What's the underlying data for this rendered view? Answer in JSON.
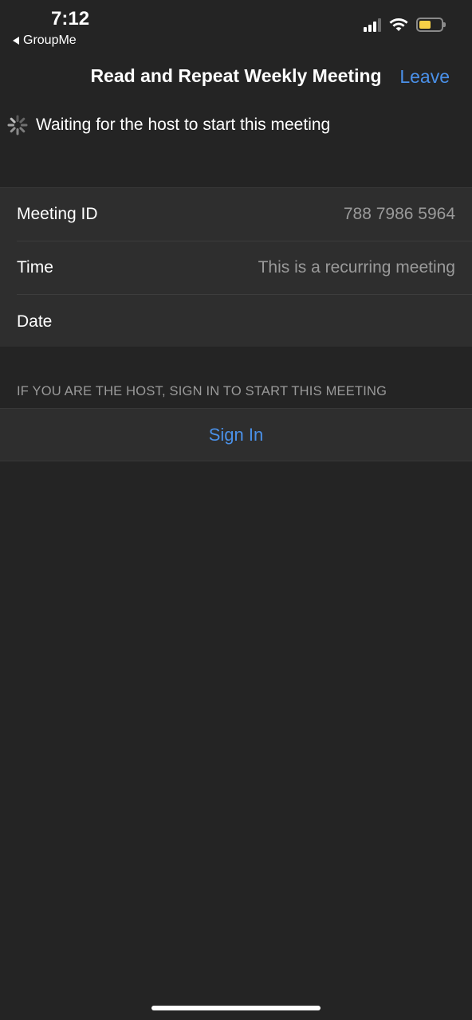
{
  "status_bar": {
    "time": "7:12",
    "back_app_label": "GroupMe",
    "battery_color": "#f7d046"
  },
  "nav": {
    "title": "Read and Repeat Weekly Meeting",
    "leave_label": "Leave",
    "accent_color": "#4a90e8"
  },
  "waiting": {
    "icon": "spinner-icon",
    "text": "Waiting for the host to start this meeting"
  },
  "info_rows": [
    {
      "label": "Meeting ID",
      "value": "788 7986 5964"
    },
    {
      "label": "Time",
      "value": "This is a recurring meeting"
    },
    {
      "label": "Date",
      "value": ""
    }
  ],
  "host_section": {
    "note": "IF YOU ARE THE HOST, SIGN IN TO START THIS MEETING",
    "sign_in_label": "Sign In"
  }
}
